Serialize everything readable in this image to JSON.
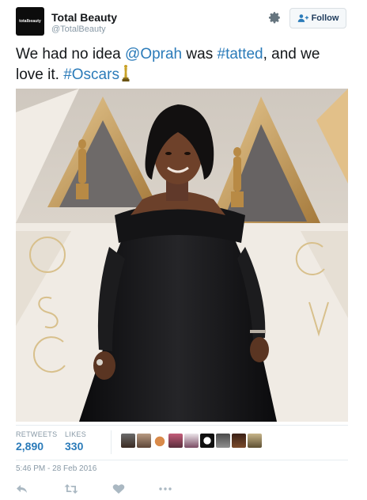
{
  "account": {
    "display_name": "Total Beauty",
    "handle": "@TotalBeauty",
    "avatar_text": "totalbeauty"
  },
  "header": {
    "follow_label": "Follow",
    "settings_icon": "gear-icon",
    "follow_icon": "add-user-icon"
  },
  "tweet": {
    "text_1": "We had no idea ",
    "mention": "@Oprah",
    "text_2": " was ",
    "hashtag_1": "#tatted",
    "text_3": ", and we love it. ",
    "hashtag_2": "#Oscars",
    "emoji": "oscar-statue-icon"
  },
  "photo": {
    "backdrop_text": "OSCARS"
  },
  "stats": {
    "retweets_label": "RETWEETS",
    "retweets_value": "2,890",
    "likes_label": "LIKES",
    "likes_value": "330",
    "liker_count_shown": 9
  },
  "timestamp": "5:46 PM - 28 Feb 2016",
  "actions": [
    "reply-icon",
    "retweet-icon",
    "like-icon",
    "more-icon"
  ],
  "colors": {
    "link": "#2b7bb9",
    "muted": "#8899a6",
    "text": "#14171a",
    "divider": "#e6ecf0"
  }
}
